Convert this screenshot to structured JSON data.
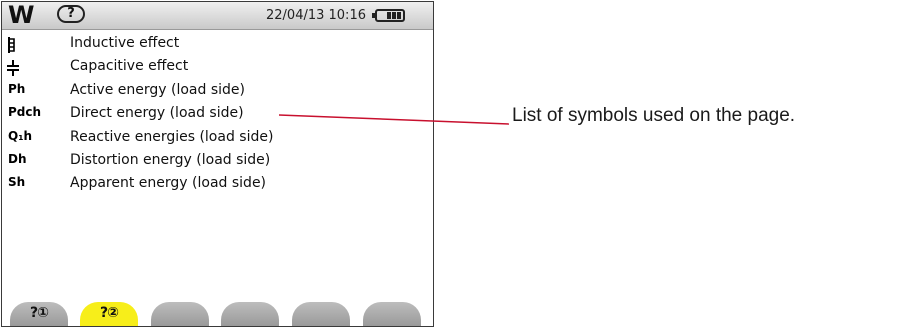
{
  "status_bar": {
    "mode_label": "W",
    "help_label": "?",
    "datetime": "22/04/13 10:16",
    "battery_icon": "battery-icon"
  },
  "symbols": [
    {
      "symbol": "",
      "icon": "inductive-effect-icon",
      "description": "Inductive effect"
    },
    {
      "symbol": "",
      "icon": "capacitive-effect-icon",
      "description": "Capacitive effect"
    },
    {
      "symbol": "Ph",
      "description": "Active energy (load side)"
    },
    {
      "symbol": "Pdch",
      "description": "Direct energy (load side)"
    },
    {
      "symbol": "Q₁h",
      "description": "Reactive energies (load side)"
    },
    {
      "symbol": "Dh",
      "description": "Distortion energy (load side)"
    },
    {
      "symbol": "Sh",
      "description": "Apparent energy (load side)"
    }
  ],
  "tabs": [
    {
      "label": "?①",
      "active": false
    },
    {
      "label": "?②",
      "active": true
    },
    {
      "label": "",
      "active": false
    },
    {
      "label": "",
      "active": false
    },
    {
      "label": "",
      "active": false
    },
    {
      "label": "",
      "active": false
    }
  ],
  "callout": {
    "text": "List of symbols used on the page.",
    "line_color": "#c8102e"
  },
  "colors": {
    "active_tab": "#f7ee1a",
    "inactive_tab": "#a8a8a8"
  }
}
